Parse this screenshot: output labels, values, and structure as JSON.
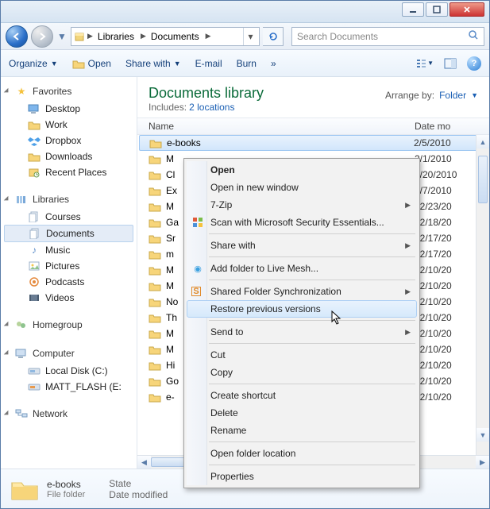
{
  "breadcrumb": {
    "seg1": "Libraries",
    "seg2": "Documents"
  },
  "search": {
    "placeholder": "Search Documents"
  },
  "toolbar": {
    "organize": "Organize",
    "open": "Open",
    "share": "Share with",
    "email": "E-mail",
    "burn": "Burn"
  },
  "nav": {
    "favorites": {
      "label": "Favorites",
      "items": [
        "Desktop",
        "Work",
        "Dropbox",
        "Downloads",
        "Recent Places"
      ]
    },
    "libraries": {
      "label": "Libraries",
      "items": [
        "Courses",
        "Documents",
        "Music",
        "Pictures",
        "Podcasts",
        "Videos"
      ],
      "selected": 1
    },
    "homegroup": {
      "label": "Homegroup"
    },
    "computer": {
      "label": "Computer",
      "items": [
        "Local Disk (C:)",
        "MATT_FLASH (E:"
      ]
    },
    "network": {
      "label": "Network"
    }
  },
  "library": {
    "title": "Documents library",
    "includes_pre": "Includes:",
    "includes_link": "2 locations",
    "arrange_label": "Arrange by:",
    "arrange_value": "Folder"
  },
  "columns": {
    "name": "Name",
    "date": "Date mo"
  },
  "rows": [
    {
      "name": "e-books",
      "date": "2/5/2010"
    },
    {
      "name": "M",
      "date": "2/1/2010"
    },
    {
      "name": "Cl",
      "date": "1/20/2010"
    },
    {
      "name": "Ex",
      "date": "1/7/2010"
    },
    {
      "name": "M",
      "date": "12/23/20"
    },
    {
      "name": "Ga",
      "date": "12/18/20"
    },
    {
      "name": "Sr",
      "date": "12/17/20"
    },
    {
      "name": "m",
      "date": "12/17/20"
    },
    {
      "name": "M",
      "date": "12/10/20"
    },
    {
      "name": "M",
      "date": "12/10/20"
    },
    {
      "name": "No",
      "date": "12/10/20"
    },
    {
      "name": "Th",
      "date": "12/10/20"
    },
    {
      "name": "M",
      "date": "12/10/20"
    },
    {
      "name": "M",
      "date": "12/10/20"
    },
    {
      "name": "Hi",
      "date": "12/10/20"
    },
    {
      "name": "Go",
      "date": "12/10/20"
    },
    {
      "name": "e-",
      "date": "12/10/20"
    }
  ],
  "context": {
    "open": "Open",
    "open_new": "Open in new window",
    "sevenzip": "7-Zip",
    "scan": "Scan with Microsoft Security Essentials...",
    "share": "Share with",
    "livemesh": "Add folder to Live Mesh...",
    "sfs": "Shared Folder Synchronization",
    "restore": "Restore previous versions",
    "sendto": "Send to",
    "cut": "Cut",
    "copy": "Copy",
    "shortcut": "Create shortcut",
    "delete": "Delete",
    "rename": "Rename",
    "openloc": "Open folder location",
    "props": "Properties"
  },
  "details": {
    "name": "e-books",
    "type": "File folder",
    "state_label": "State",
    "date_label": "Date modified"
  }
}
